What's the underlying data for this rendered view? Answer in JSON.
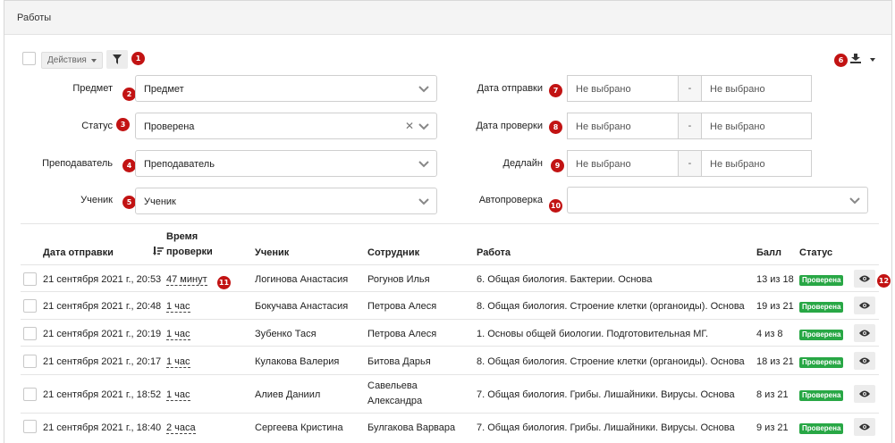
{
  "header": {
    "title": "Работы"
  },
  "toolbar": {
    "actions_label": "Действия"
  },
  "badges": [
    "1",
    "2",
    "3",
    "4",
    "5",
    "6",
    "7",
    "8",
    "9",
    "10",
    "11",
    "12"
  ],
  "filters": {
    "subject": {
      "label": "Предмет",
      "value": "Предмет"
    },
    "status": {
      "label": "Статус",
      "value": "Проверена"
    },
    "teacher": {
      "label": "Преподаватель",
      "value": "Преподаватель"
    },
    "student": {
      "label": "Ученик",
      "value": "Ученик"
    },
    "sent_date": {
      "label": "Дата отправки",
      "from": "Не выбрано",
      "sep": "-",
      "to": "Не выбрано"
    },
    "check_date": {
      "label": "Дата проверки",
      "from": "Не выбрано",
      "sep": "-",
      "to": "Не выбрано"
    },
    "deadline": {
      "label": "Дедлайн",
      "from": "Не выбрано",
      "sep": "-",
      "to": "Не выбрано"
    },
    "autocheck": {
      "label": "Автопроверка",
      "value": ""
    }
  },
  "table": {
    "headers": {
      "sent": "Дата отправки",
      "check_time_1": "Время",
      "check_time_2": "проверки",
      "student": "Ученик",
      "employee": "Сотрудник",
      "work": "Работа",
      "score": "Балл",
      "status": "Статус"
    },
    "rows": [
      {
        "sent": "21 сентября 2021 г., 20:53",
        "duration": "47 минут",
        "student": "Логинова Анастасия",
        "employee": "Рогунов Илья",
        "work": "6. Общая биология. Бактерии. Основа",
        "score": "13 из 18",
        "status": "Проверена"
      },
      {
        "sent": "21 сентября 2021 г., 20:48",
        "duration": "1 час",
        "student": "Бокучава Анастасия",
        "employee": "Петрова Алеся",
        "work": "8. Общая биология. Строение клетки (органоиды). Основа",
        "score": "19 из 21",
        "status": "Проверена"
      },
      {
        "sent": "21 сентября 2021 г., 20:19",
        "duration": "1 час",
        "student": "Зубенко Тася",
        "employee": "Петрова Алеся",
        "work": "1. Основы общей биологии. Подготовительная МГ.",
        "score": "4 из 8",
        "status": "Проверена"
      },
      {
        "sent": "21 сентября 2021 г., 20:17",
        "duration": "1 час",
        "student": "Кулакова Валерия",
        "employee": "Битова Дарья",
        "work": "8. Общая биология. Строение клетки (органоиды). Основа",
        "score": "18 из 21",
        "status": "Проверена"
      },
      {
        "sent": "21 сентября 2021 г., 18:52",
        "duration": "1 час",
        "student": "Алиев Даниил",
        "employee": "Савельева Александра",
        "work": "7. Общая биология. Грибы. Лишайники. Вирусы. Основа",
        "score": "8 из 21",
        "status": "Проверена"
      },
      {
        "sent": "21 сентября 2021 г., 18:40",
        "duration": "2 часа",
        "student": "Сергеева Кристина",
        "employee": "Булгакова Варвара",
        "work": "7. Общая биология. Грибы. Лишайники. Вирусы. Основа",
        "score": "9 из 21",
        "status": "Проверена"
      }
    ]
  },
  "colors": {
    "badge": "#c21313",
    "status_ok": "#28a745"
  },
  "icons": {
    "filter": "filter-icon",
    "export": "download-icon",
    "view": "eye-icon",
    "sort": "sort-desc-icon",
    "chevron": "chevron-down-icon",
    "clear": "clear-x-icon"
  }
}
